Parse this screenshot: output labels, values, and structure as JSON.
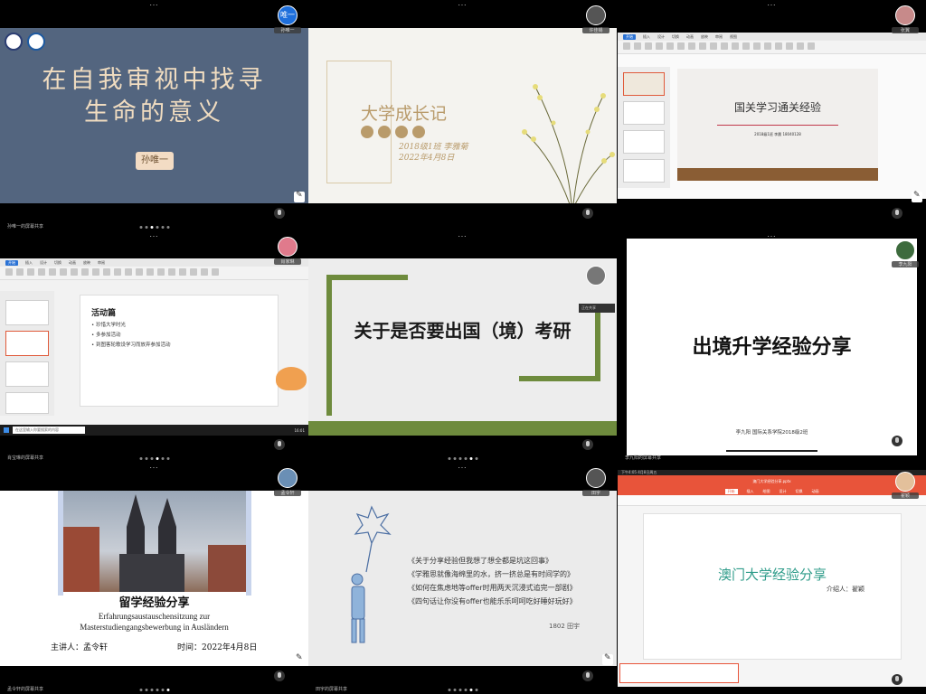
{
  "tiles": [
    {
      "participant": "孙唯一",
      "avatar_text": "唯一",
      "caption": "孙唯一的屏幕共享",
      "slide": {
        "title_line1": "在自我审视中找寻",
        "title_line2": "生命的意义",
        "presenter": "孙唯一"
      }
    },
    {
      "participant": "许佳锡",
      "caption": "",
      "slide": {
        "title": "大学成长记",
        "line1": "2018级1班 李雅菊",
        "line2": "2022年4月8日"
      }
    },
    {
      "participant": "张翼",
      "caption": "",
      "slide": {
        "title": "国关学习通关经验",
        "subtitle": "2018级1班 李晨 18040128",
        "file_tab": "国关学...pptx"
      }
    },
    {
      "participant": "肖家琳",
      "caption": "肖宝琳的屏幕共享",
      "slide": {
        "heading": "活动篇",
        "bullets": [
          "珍惜大学时光",
          "多参加活动",
          "到图客轮歌设学习而放弃参加活动"
        ],
        "file_tab": "刚刚分享.pptx",
        "taskbar_search": "在这里输入你要搜索的内容",
        "taskbar_time": "16:01",
        "taskbar_date": "2022/4/8"
      }
    },
    {
      "participant": "张紫",
      "caption": "",
      "slide": {
        "title": "关于是否要出国（境）考研",
        "popup": "正在共享"
      }
    },
    {
      "participant": "李九阳",
      "caption": "李九阳的屏幕共享",
      "slide": {
        "title": "出境升学经验分享",
        "footer": "李九阳 国际关系学院2018级2班"
      }
    },
    {
      "participant": "孟令轩",
      "caption": "孟令轩的屏幕共享",
      "slide": {
        "title": "留学经验分享",
        "german_line1": "Erfahrungsaustauschensitzung zur",
        "german_line2": "Masterstudiengangsbewerbung in Ausländern",
        "speaker": "主讲人：孟令轩",
        "date": "时间：2022年4月8日"
      }
    },
    {
      "participant": "田宇",
      "caption": "田宇的屏幕共享",
      "slide": {
        "lines": [
          "《关于分享经验但我想了想全都是坑这回事》",
          "《学雅思就像海绵里的水，挤一挤总是有时间学的》",
          "《如何在焦虑地等offer时用两天沉浸式追完一部剧》",
          "《四句话让你没有offer也能乐乐呵呵吃好睡好玩好》"
        ],
        "signature": "1802 田宇"
      }
    },
    {
      "participant": "翟颖",
      "caption": "",
      "slide": {
        "title": "澳门大学经验分享",
        "intro": "介绍人：翟颖",
        "file_tab": "澳门大学经验分享.pptx",
        "status_time": "下午4:05  4月8日周五"
      }
    }
  ],
  "colors": {
    "tile1_bg": "#53657f",
    "tile1_title": "#f0dcc0",
    "tile2_gold": "#b99b6b",
    "tile5_green": "#6e8b3d",
    "tile9_orange": "#e8543a",
    "tile9_title": "#2f9c8a",
    "tile8_text": "#4c6fa3",
    "active_blue": "#2a72d5"
  }
}
